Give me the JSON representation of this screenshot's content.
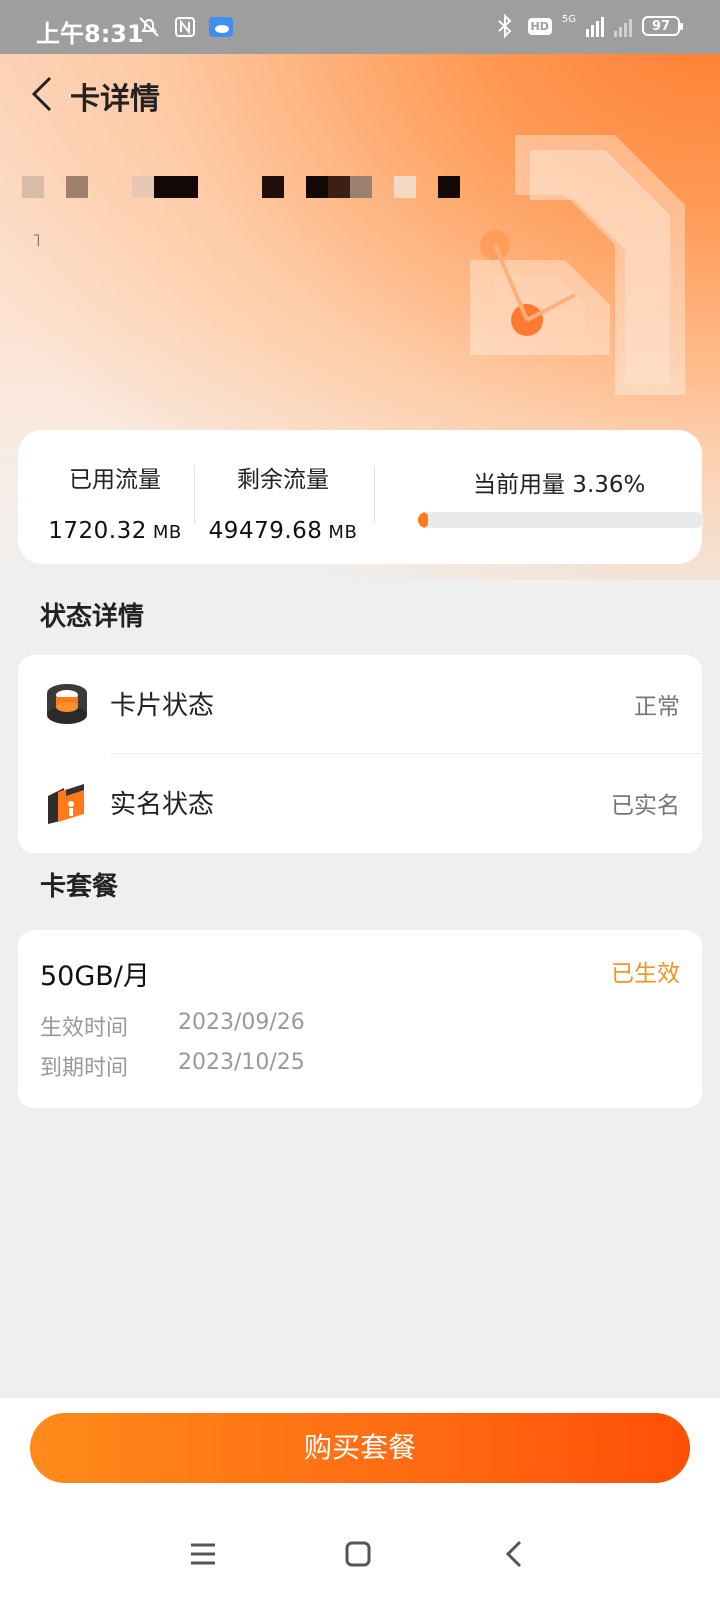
{
  "status_bar": {
    "time": "上午8:31",
    "network_label": "5G",
    "hd_label": "HD",
    "battery": "97"
  },
  "header": {
    "title": "卡详情"
  },
  "usage": {
    "used_label": "已用流量",
    "used_value": "1720.32",
    "used_unit": "MB",
    "remaining_label": "剩余流量",
    "remaining_value": "49479.68",
    "remaining_unit": "MB",
    "current_label": "当前用量 3.36%",
    "percent": 3.36,
    "accent_color": "#ff7a1a"
  },
  "status_section": {
    "title": "状态详情",
    "rows": [
      {
        "label": "卡片状态",
        "value": "正常",
        "icon": "sim-card-icon"
      },
      {
        "label": "实名状态",
        "value": "已实名",
        "icon": "id-badge-icon"
      }
    ]
  },
  "plan_section": {
    "title": "卡套餐",
    "plan_name": "50GB/月",
    "plan_state": "已生效",
    "effective_label": "生效时间",
    "effective_date": "2023/09/26",
    "expire_label": "到期时间",
    "expire_date": "2023/10/25",
    "state_color": "#f5931e"
  },
  "footer": {
    "buy_label": "购买套餐"
  }
}
